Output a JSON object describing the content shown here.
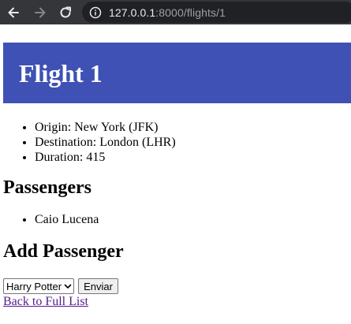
{
  "browser": {
    "url_host": "127.0.0.1",
    "url_rest": ":8000/flights/1",
    "icons": {
      "back": "arrow-left-icon",
      "forward": "arrow-right-icon",
      "reload": "reload-icon",
      "info": "info-icon"
    }
  },
  "flight": {
    "title": "Flight 1",
    "origin": "Origin: New York (JFK)",
    "destination": "Destination: London (LHR)",
    "duration": "Duration: 415"
  },
  "passengers": {
    "heading": "Passengers",
    "items": [
      "Caio Lucena"
    ]
  },
  "add_passenger": {
    "heading": "Add Passenger",
    "selected": "Harry Potter",
    "submit_label": "Enviar"
  },
  "back_link": "Back to Full List",
  "colors": {
    "banner": "#3f51b5",
    "chrome": "#35363a",
    "omnibox": "#202124",
    "link_visited": "#551a8b"
  }
}
